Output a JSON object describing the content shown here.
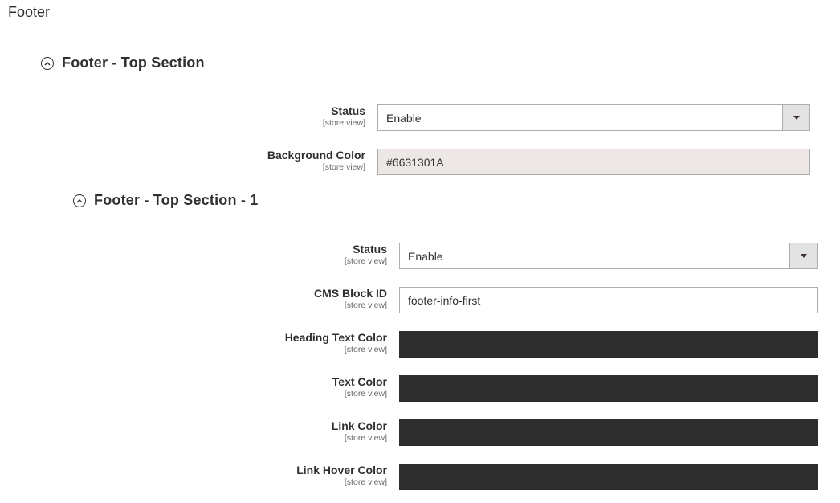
{
  "page": {
    "title": "Footer"
  },
  "top_section": {
    "title": "Footer - Top Section",
    "status": {
      "label": "Status",
      "scope": "[store view]",
      "value": "Enable"
    },
    "background_color": {
      "label": "Background Color",
      "scope": "[store view]",
      "value": "#6631301A",
      "swatch": "#ede7e6"
    }
  },
  "sub_section": {
    "title": "Footer - Top Section - 1",
    "status": {
      "label": "Status",
      "scope": "[store view]",
      "value": "Enable"
    },
    "cms_block": {
      "label": "CMS Block ID",
      "scope": "[store view]",
      "value": "footer-info-first"
    },
    "heading_text_color": {
      "label": "Heading Text Color",
      "scope": "[store view]",
      "value": "",
      "swatch": "#2d2d2d"
    },
    "text_color": {
      "label": "Text Color",
      "scope": "[store view]",
      "value": "",
      "swatch": "#2d2d2d"
    },
    "link_color": {
      "label": "Link Color",
      "scope": "[store view]",
      "value": "",
      "swatch": "#2d2d2d"
    },
    "link_hover_color": {
      "label": "Link Hover Color",
      "scope": "[store view]",
      "value": "",
      "swatch": "#2d2d2d"
    }
  }
}
